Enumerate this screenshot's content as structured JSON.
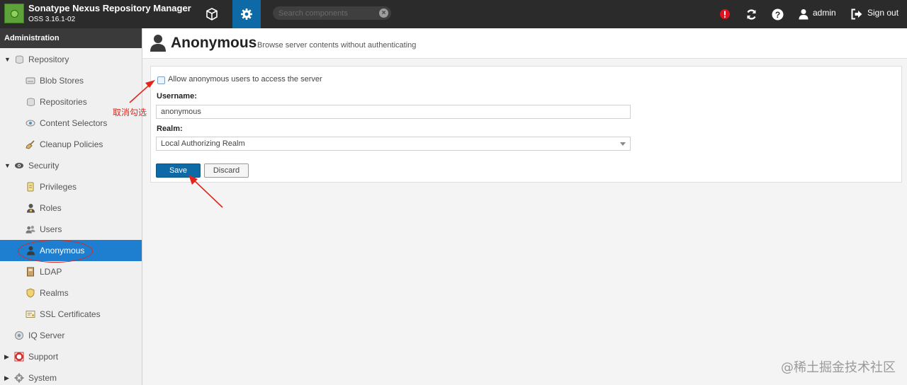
{
  "header": {
    "app_title": "Sonatype Nexus Repository Manager",
    "app_version": "OSS 3.16.1-02",
    "search_placeholder": "Search components",
    "username": "admin",
    "signout_label": "Sign out"
  },
  "sidebar": {
    "section_title": "Administration",
    "items": [
      {
        "label": "Repository",
        "icon": "database-icon"
      },
      {
        "label": "Blob Stores",
        "icon": "storage-icon"
      },
      {
        "label": "Repositories",
        "icon": "database-icon"
      },
      {
        "label": "Content Selectors",
        "icon": "eye-icon"
      },
      {
        "label": "Cleanup Policies",
        "icon": "broom-icon"
      },
      {
        "label": "Security",
        "icon": "eye-shield-icon"
      },
      {
        "label": "Privileges",
        "icon": "badge-icon"
      },
      {
        "label": "Roles",
        "icon": "role-icon"
      },
      {
        "label": "Users",
        "icon": "users-icon"
      },
      {
        "label": "Anonymous",
        "icon": "user-icon"
      },
      {
        "label": "LDAP",
        "icon": "book-icon"
      },
      {
        "label": "Realms",
        "icon": "shield-icon"
      },
      {
        "label": "SSL Certificates",
        "icon": "certificate-icon"
      },
      {
        "label": "IQ Server",
        "icon": "gear-eye-icon"
      },
      {
        "label": "Support",
        "icon": "lifebuoy-icon"
      },
      {
        "label": "System",
        "icon": "gear-icon"
      }
    ]
  },
  "page": {
    "title": "Anonymous",
    "subtitle": "Browse server contents without authenticating",
    "checkbox_label": "Allow anonymous users to access the server",
    "checkbox_checked": false,
    "username_label": "Username:",
    "username_value": "anonymous",
    "realm_label": "Realm:",
    "realm_value": "Local Authorizing Realm",
    "save_label": "Save",
    "discard_label": "Discard"
  },
  "annotations": {
    "uncheck_note": "取消勾选",
    "annotation_color": "#e1251b"
  },
  "watermark": "@稀土掘金技术社区",
  "colors": {
    "accent": "#0d6aa6",
    "selected": "#1e7fd0",
    "header_bg": "#2b2b2b",
    "alert": "#e0141e"
  }
}
